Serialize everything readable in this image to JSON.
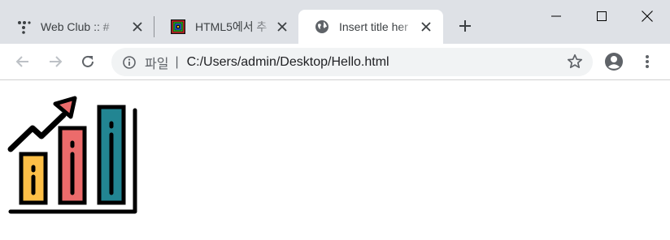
{
  "tabs": [
    {
      "title": "Web Club :: #",
      "icon": "webclub-icon",
      "active": false
    },
    {
      "title": "HTML5에서 추",
      "icon": "html5-icon",
      "active": false
    },
    {
      "title": "Insert title her",
      "icon": "globe-icon",
      "active": true
    }
  ],
  "omnibox": {
    "scheme_label": "파일",
    "divider": "|",
    "url": "C:/Users/admin/Desktop/Hello.html"
  },
  "page_image": {
    "description_icon": "growth-bar-chart-icon",
    "colors": {
      "bar1": "#fdbf47",
      "bar2": "#ec6b6b",
      "bar3": "#228592",
      "arrow": "#ec6b6b",
      "outline": "#000000"
    }
  },
  "theme": {
    "tabstrip_bg": "#dee1e6",
    "active_tab_bg": "#ffffff",
    "omnibox_bg": "#f1f3f4",
    "icon_color": "#5f6368"
  }
}
